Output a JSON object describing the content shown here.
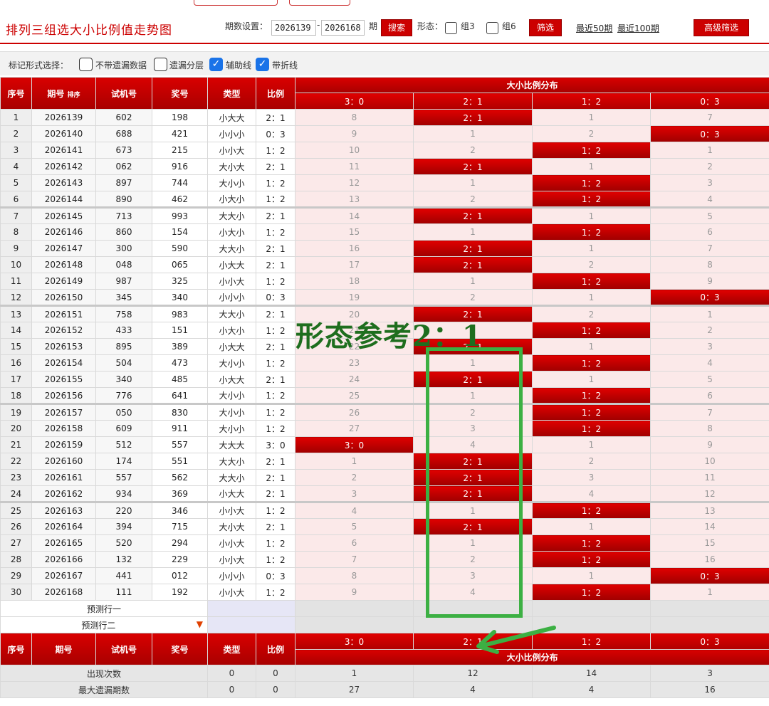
{
  "header": {
    "title": "排列三组选大小比例值走势图",
    "period_setting_label": "期数设置：",
    "period_from": "2026139",
    "period_dash": "-",
    "period_to": "2026168",
    "period_unit": "期",
    "search_label": "搜索",
    "form_label": "形态：",
    "group3_label": "组3",
    "group6_label": "组6",
    "filter_label": "筛选",
    "recent50_label": "最近50期",
    "recent100_label": "最近100期",
    "advanced_label": "高级筛选"
  },
  "markbar": {
    "label": "标记形式选择：",
    "options": [
      {
        "label": "不带遗漏数据",
        "checked": false
      },
      {
        "label": "遗漏分层",
        "checked": false
      },
      {
        "label": "辅助线",
        "checked": true
      },
      {
        "label": "带折线",
        "checked": true
      }
    ]
  },
  "table": {
    "headers": {
      "seq": "序号",
      "period": "期号",
      "sort": "排序",
      "test": "试机号",
      "win": "奖号",
      "type": "类型",
      "ratio": "比例",
      "dist_title": "大小比例分布"
    },
    "dist_columns": [
      "3：0",
      "2：1",
      "1：2",
      "0：3"
    ],
    "rows": [
      {
        "seq": "1",
        "period": "2026139",
        "test": "602",
        "win": "198",
        "type": "小大大",
        "ratio": "2：1",
        "d": [
          "8",
          "2：1",
          "1",
          "7"
        ],
        "hit": 1
      },
      {
        "seq": "2",
        "period": "2026140",
        "test": "688",
        "win": "421",
        "type": "小小小",
        "ratio": "0：3",
        "d": [
          "9",
          "1",
          "2",
          "0：3"
        ],
        "hit": 3
      },
      {
        "seq": "3",
        "period": "2026141",
        "test": "673",
        "win": "215",
        "type": "小小大",
        "ratio": "1：2",
        "d": [
          "10",
          "2",
          "1：2",
          "1"
        ],
        "hit": 2
      },
      {
        "seq": "4",
        "period": "2026142",
        "test": "062",
        "win": "916",
        "type": "大小大",
        "ratio": "2：1",
        "d": [
          "11",
          "2：1",
          "1",
          "2"
        ],
        "hit": 1
      },
      {
        "seq": "5",
        "period": "2026143",
        "test": "897",
        "win": "744",
        "type": "大小小",
        "ratio": "1：2",
        "d": [
          "12",
          "1",
          "1：2",
          "3"
        ],
        "hit": 2
      },
      {
        "seq": "6",
        "period": "2026144",
        "test": "890",
        "win": "462",
        "type": "小大小",
        "ratio": "1：2",
        "d": [
          "13",
          "2",
          "1：2",
          "4"
        ],
        "hit": 2
      },
      {
        "seq": "7",
        "period": "2026145",
        "test": "713",
        "win": "993",
        "type": "大大小",
        "ratio": "2：1",
        "d": [
          "14",
          "2：1",
          "1",
          "5"
        ],
        "hit": 1
      },
      {
        "seq": "8",
        "period": "2026146",
        "test": "860",
        "win": "154",
        "type": "小大小",
        "ratio": "1：2",
        "d": [
          "15",
          "1",
          "1：2",
          "6"
        ],
        "hit": 2
      },
      {
        "seq": "9",
        "period": "2026147",
        "test": "300",
        "win": "590",
        "type": "大大小",
        "ratio": "2：1",
        "d": [
          "16",
          "2：1",
          "1",
          "7"
        ],
        "hit": 1
      },
      {
        "seq": "10",
        "period": "2026148",
        "test": "048",
        "win": "065",
        "type": "小大大",
        "ratio": "2：1",
        "d": [
          "17",
          "2：1",
          "2",
          "8"
        ],
        "hit": 1
      },
      {
        "seq": "11",
        "period": "2026149",
        "test": "987",
        "win": "325",
        "type": "小小大",
        "ratio": "1：2",
        "d": [
          "18",
          "1",
          "1：2",
          "9"
        ],
        "hit": 2
      },
      {
        "seq": "12",
        "period": "2026150",
        "test": "345",
        "win": "340",
        "type": "小小小",
        "ratio": "0：3",
        "d": [
          "19",
          "2",
          "1",
          "0：3"
        ],
        "hit": 3
      },
      {
        "seq": "13",
        "period": "2026151",
        "test": "758",
        "win": "983",
        "type": "大大小",
        "ratio": "2：1",
        "d": [
          "20",
          "2：1",
          "2",
          "1"
        ],
        "hit": 1
      },
      {
        "seq": "14",
        "period": "2026152",
        "test": "433",
        "win": "151",
        "type": "小大小",
        "ratio": "1：2",
        "d": [
          "21",
          "1",
          "1：2",
          "2"
        ],
        "hit": 2
      },
      {
        "seq": "15",
        "period": "2026153",
        "test": "895",
        "win": "389",
        "type": "小大大",
        "ratio": "2：1",
        "d": [
          "22",
          "2：1",
          "1",
          "3"
        ],
        "hit": 1
      },
      {
        "seq": "16",
        "period": "2026154",
        "test": "504",
        "win": "473",
        "type": "大小小",
        "ratio": "1：2",
        "d": [
          "23",
          "1",
          "1：2",
          "4"
        ],
        "hit": 2
      },
      {
        "seq": "17",
        "period": "2026155",
        "test": "340",
        "win": "485",
        "type": "小大大",
        "ratio": "2：1",
        "d": [
          "24",
          "2：1",
          "1",
          "5"
        ],
        "hit": 1
      },
      {
        "seq": "18",
        "period": "2026156",
        "test": "776",
        "win": "641",
        "type": "大小小",
        "ratio": "1：2",
        "d": [
          "25",
          "1",
          "1：2",
          "6"
        ],
        "hit": 2
      },
      {
        "seq": "19",
        "period": "2026157",
        "test": "050",
        "win": "830",
        "type": "大小小",
        "ratio": "1：2",
        "d": [
          "26",
          "2",
          "1：2",
          "7"
        ],
        "hit": 2
      },
      {
        "seq": "20",
        "period": "2026158",
        "test": "609",
        "win": "911",
        "type": "大小小",
        "ratio": "1：2",
        "d": [
          "27",
          "3",
          "1：2",
          "8"
        ],
        "hit": 2
      },
      {
        "seq": "21",
        "period": "2026159",
        "test": "512",
        "win": "557",
        "type": "大大大",
        "ratio": "3：0",
        "d": [
          "3：0",
          "4",
          "1",
          "9"
        ],
        "hit": 0
      },
      {
        "seq": "22",
        "period": "2026160",
        "test": "174",
        "win": "551",
        "type": "大大小",
        "ratio": "2：1",
        "d": [
          "1",
          "2：1",
          "2",
          "10"
        ],
        "hit": 1
      },
      {
        "seq": "23",
        "period": "2026161",
        "test": "557",
        "win": "562",
        "type": "大大小",
        "ratio": "2：1",
        "d": [
          "2",
          "2：1",
          "3",
          "11"
        ],
        "hit": 1
      },
      {
        "seq": "24",
        "period": "2026162",
        "test": "934",
        "win": "369",
        "type": "小大大",
        "ratio": "2：1",
        "d": [
          "3",
          "2：1",
          "4",
          "12"
        ],
        "hit": 1
      },
      {
        "seq": "25",
        "period": "2026163",
        "test": "220",
        "win": "346",
        "type": "小小大",
        "ratio": "1：2",
        "d": [
          "4",
          "1",
          "1：2",
          "13"
        ],
        "hit": 2
      },
      {
        "seq": "26",
        "period": "2026164",
        "test": "394",
        "win": "715",
        "type": "大小大",
        "ratio": "2：1",
        "d": [
          "5",
          "2：1",
          "1",
          "14"
        ],
        "hit": 1
      },
      {
        "seq": "27",
        "period": "2026165",
        "test": "520",
        "win": "294",
        "type": "小小大",
        "ratio": "1：2",
        "d": [
          "6",
          "1",
          "1：2",
          "15"
        ],
        "hit": 2
      },
      {
        "seq": "28",
        "period": "2026166",
        "test": "132",
        "win": "229",
        "type": "小小大",
        "ratio": "1：2",
        "d": [
          "7",
          "2",
          "1：2",
          "16"
        ],
        "hit": 2
      },
      {
        "seq": "29",
        "period": "2026167",
        "test": "441",
        "win": "012",
        "type": "小小小",
        "ratio": "0：3",
        "d": [
          "8",
          "3",
          "1",
          "0：3"
        ],
        "hit": 3
      },
      {
        "seq": "30",
        "period": "2026168",
        "test": "111",
        "win": "192",
        "type": "小小大",
        "ratio": "1：2",
        "d": [
          "9",
          "4",
          "1：2",
          "1"
        ],
        "hit": 2
      }
    ],
    "predict_rows": [
      "预测行一",
      "预测行二"
    ],
    "footer_headers": {
      "seq": "序号",
      "period": "期号",
      "test": "试机号",
      "win": "奖号",
      "type": "类型",
      "ratio": "比例",
      "dist_title": "大小比例分布"
    },
    "stats": [
      {
        "label": "出现次数",
        "type": "0",
        "ratio": "0",
        "values": [
          "1",
          "12",
          "14",
          "3"
        ]
      },
      {
        "label": "最大遗漏期数",
        "type": "0",
        "ratio": "0",
        "values": [
          "27",
          "4",
          "4",
          "16"
        ]
      }
    ]
  },
  "annotation": {
    "text": "形态参考2：1",
    "color": "#3cb043"
  },
  "colors": {
    "brand_red": "#c00000",
    "dist_bg": "#fbe9e9"
  }
}
